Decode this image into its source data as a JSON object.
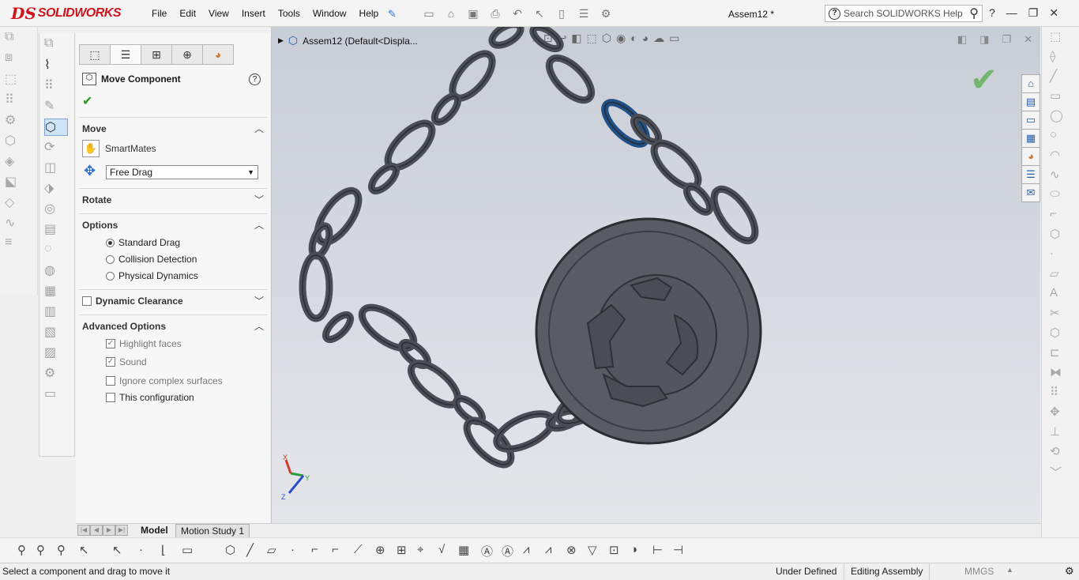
{
  "app": {
    "logo_ds": "DS",
    "logo_name": "SOLIDWORKS",
    "menu": [
      "File",
      "Edit",
      "View",
      "Insert",
      "Tools",
      "Window",
      "Help"
    ],
    "document_title": "Assem12 *",
    "search_placeholder": "Search SOLIDWORKS Help",
    "help_glyph": "?"
  },
  "property_manager": {
    "title": "Move Component",
    "help": "?",
    "move": {
      "header": "Move",
      "smartmates_label": "SmartMates",
      "drag_mode": "Free Drag"
    },
    "rotate": {
      "header": "Rotate"
    },
    "options": {
      "header": "Options",
      "standard_drag": "Standard Drag",
      "collision_detection": "Collision Detection",
      "physical_dynamics": "Physical Dynamics",
      "selected": "Standard Drag"
    },
    "dynamic_clearance": {
      "header": "Dynamic Clearance"
    },
    "advanced": {
      "header": "Advanced Options",
      "highlight_faces": "Highlight faces",
      "sound": "Sound",
      "ignore_complex": "Ignore complex surfaces",
      "this_configuration": "This configuration"
    }
  },
  "viewport": {
    "tree_label": "Assem12  (Default<Displa...",
    "triad": {
      "x": "X",
      "y": "Y",
      "z": "Z"
    },
    "colors": {
      "chain": "#4a4d55",
      "highlight_link": "#1f4f86",
      "disc": "#595c63"
    }
  },
  "tabs": {
    "model": "Model",
    "motion": "Motion Study 1"
  },
  "status": {
    "message": "Select a component and drag to move it",
    "definition": "Under Defined",
    "mode": "Editing Assembly",
    "units": "MMGS"
  }
}
